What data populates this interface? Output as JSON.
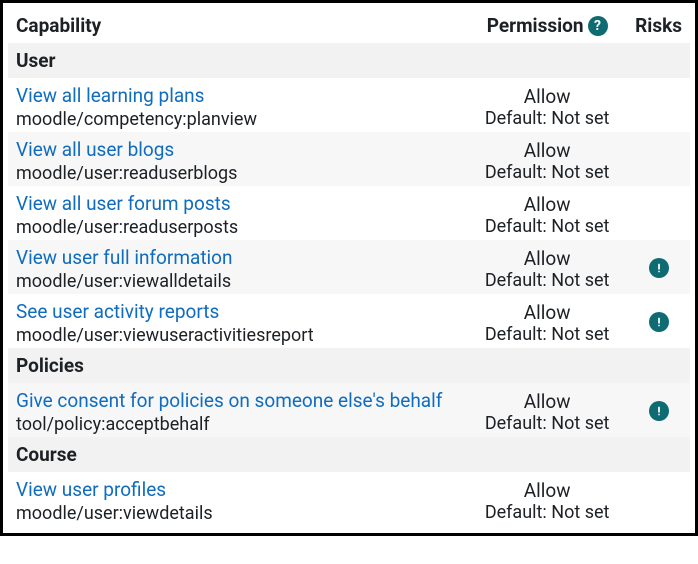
{
  "headers": {
    "capability": "Capability",
    "permission": "Permission",
    "risks": "Risks"
  },
  "help_icon_glyph": "?",
  "default_prefix": "Default: ",
  "sections": [
    {
      "title": "User",
      "rows": [
        {
          "link": "View all learning plans",
          "id": "moodle/competency:planview",
          "permission": "Allow",
          "default": "Not set",
          "risk": false
        },
        {
          "link": "View all user blogs",
          "id": "moodle/user:readuserblogs",
          "permission": "Allow",
          "default": "Not set",
          "risk": false
        },
        {
          "link": "View all user forum posts",
          "id": "moodle/user:readuserposts",
          "permission": "Allow",
          "default": "Not set",
          "risk": false
        },
        {
          "link": "View user full information",
          "id": "moodle/user:viewalldetails",
          "permission": "Allow",
          "default": "Not set",
          "risk": true
        },
        {
          "link": "See user activity reports",
          "id": "moodle/user:viewuseractivitiesreport",
          "permission": "Allow",
          "default": "Not set",
          "risk": true
        }
      ]
    },
    {
      "title": "Policies",
      "rows": [
        {
          "link": "Give consent for policies on someone else's behalf",
          "id": "tool/policy:acceptbehalf",
          "permission": "Allow",
          "default": "Not set",
          "risk": true
        }
      ]
    },
    {
      "title": "Course",
      "rows": [
        {
          "link": "View user profiles",
          "id": "moodle/user:viewdetails",
          "permission": "Allow",
          "default": "Not set",
          "risk": false
        }
      ]
    }
  ]
}
